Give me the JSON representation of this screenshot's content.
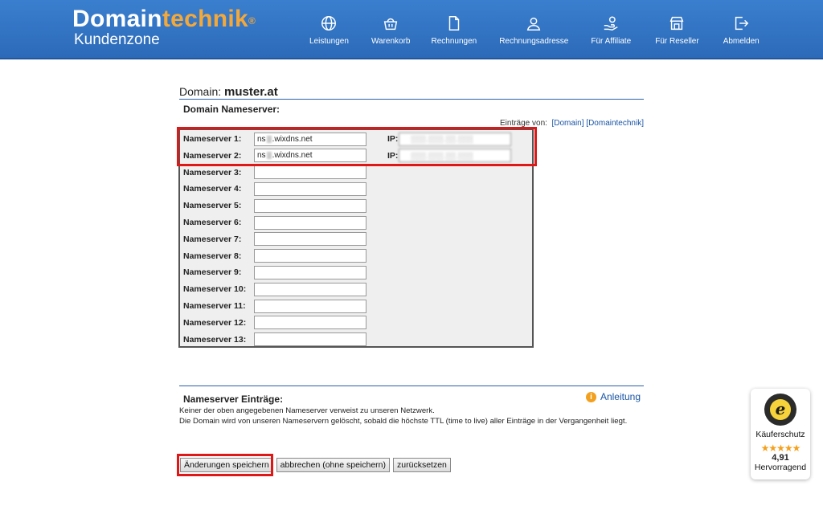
{
  "header": {
    "logo_main_a": "Domain",
    "logo_main_b": "technik",
    "logo_reg": "®",
    "logo_sub": "Kundenzone",
    "nav": [
      {
        "label": "Leistungen",
        "icon": "globe-icon"
      },
      {
        "label": "Warenkorb",
        "icon": "basket-icon"
      },
      {
        "label": "Rechnungen",
        "icon": "document-icon"
      },
      {
        "label": "Rechnungsadresse",
        "icon": "user-icon"
      },
      {
        "label": "Für Affiliate",
        "icon": "hand-coin-icon"
      },
      {
        "label": "Für Reseller",
        "icon": "store-icon"
      },
      {
        "label": "Abmelden",
        "icon": "logout-icon"
      }
    ]
  },
  "domain": {
    "prefix": "Domain:",
    "name": "muster.at",
    "section_label": "Domain Nameserver:"
  },
  "entries": {
    "prefix": "Einträge von:",
    "link_domain": "[Domain]",
    "link_technik": "[Domaintechnik]"
  },
  "nameservers": [
    {
      "label": "Nameserver 1:",
      "value_a": "ns",
      "value_b": ".wixdns.net",
      "ip_label": "IP:",
      "has_ip": true
    },
    {
      "label": "Nameserver 2:",
      "value_a": "ns",
      "value_b": ".wixdns.net",
      "ip_label": "IP:",
      "has_ip": true
    },
    {
      "label": "Nameserver 3:",
      "value_a": "",
      "value_b": "",
      "has_ip": false
    },
    {
      "label": "Nameserver 4:",
      "value_a": "",
      "value_b": "",
      "has_ip": false
    },
    {
      "label": "Nameserver 5:",
      "value_a": "",
      "value_b": "",
      "has_ip": false
    },
    {
      "label": "Nameserver 6:",
      "value_a": "",
      "value_b": "",
      "has_ip": false
    },
    {
      "label": "Nameserver 7:",
      "value_a": "",
      "value_b": "",
      "has_ip": false
    },
    {
      "label": "Nameserver 8:",
      "value_a": "",
      "value_b": "",
      "has_ip": false
    },
    {
      "label": "Nameserver 9:",
      "value_a": "",
      "value_b": "",
      "has_ip": false
    },
    {
      "label": "Nameserver 10:",
      "value_a": "",
      "value_b": "",
      "has_ip": false
    },
    {
      "label": "Nameserver 11:",
      "value_a": "",
      "value_b": "",
      "has_ip": false
    },
    {
      "label": "Nameserver 12:",
      "value_a": "",
      "value_b": "",
      "has_ip": false
    },
    {
      "label": "Nameserver 13:",
      "value_a": "",
      "value_b": "",
      "has_ip": false
    }
  ],
  "info": {
    "heading": "Nameserver Einträge:",
    "anleitung": "Anleitung",
    "line1": "Keiner der oben angegebenen Nameserver verweist zu unseren Netzwerk.",
    "line2": "Die Domain wird von unseren Nameservern gelöscht, sobald die höchste TTL (time to live) aller Einträge in der Vergangenheit liegt."
  },
  "buttons": {
    "save": "Änderungen speichern",
    "cancel": "abbrechen (ohne speichern)",
    "reset": "zurücksetzen"
  },
  "badge": {
    "seal_letter": "e",
    "title": "Käuferschutz",
    "stars": "★★★★★",
    "score": "4,91",
    "rating_word": "Hervorragend"
  },
  "colors": {
    "header_blue": "#2c6ab8",
    "accent_orange": "#f4a83a",
    "highlight_red": "#e01717",
    "link_blue": "#1a55a5"
  }
}
